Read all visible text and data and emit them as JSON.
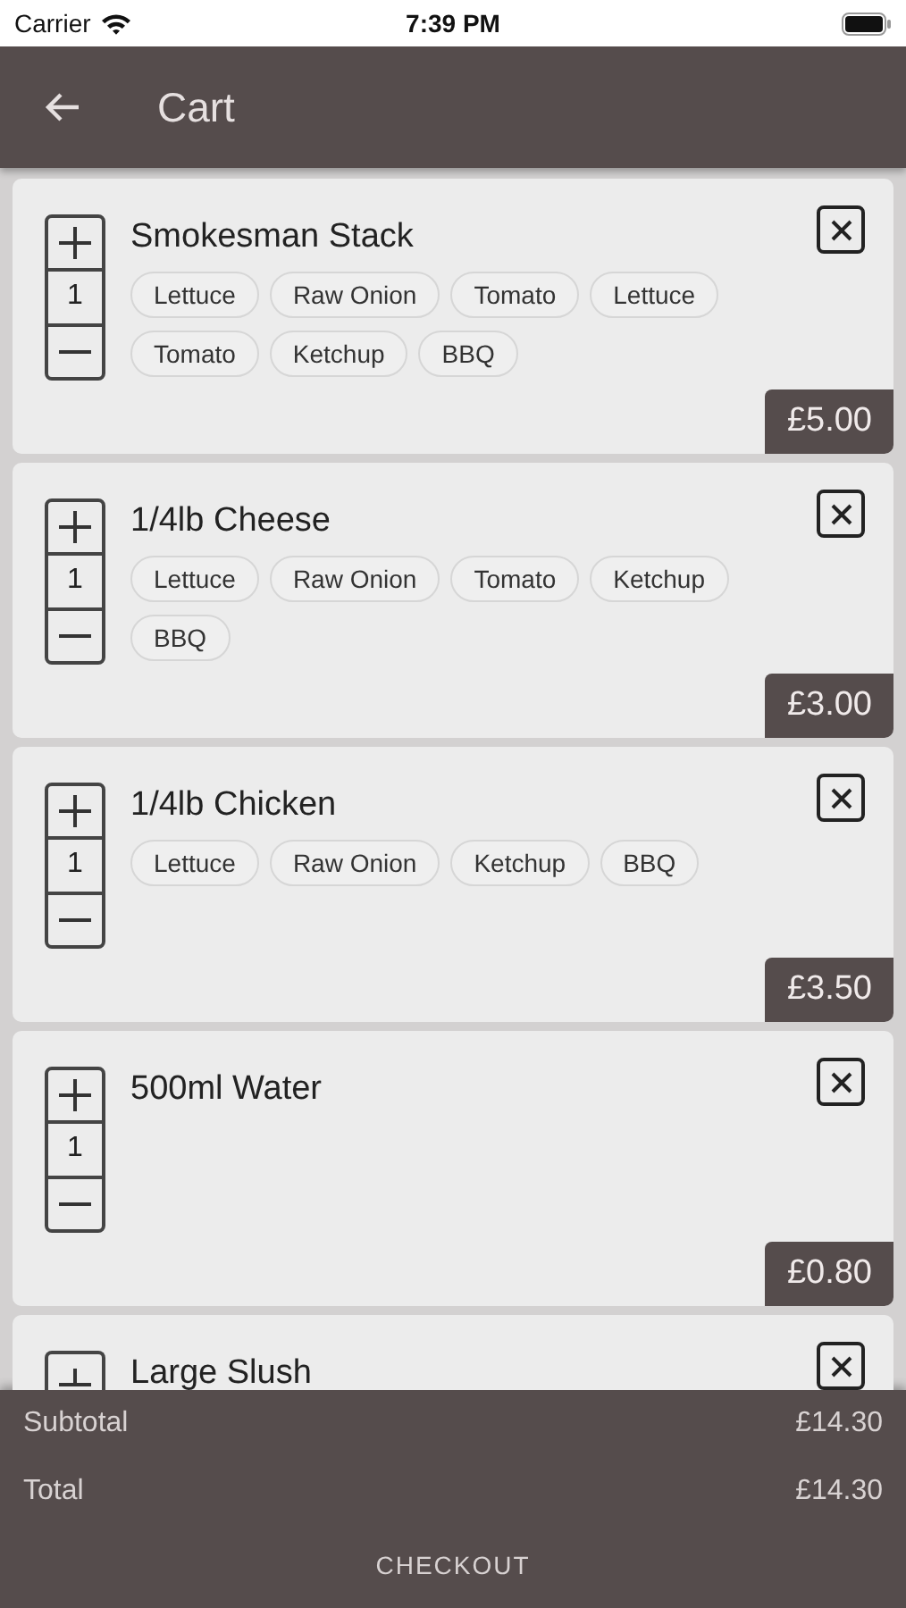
{
  "status_bar": {
    "carrier": "Carrier",
    "time": "7:39 PM"
  },
  "header": {
    "title": "Cart"
  },
  "items": [
    {
      "name": "Smokesman Stack",
      "quantity": "1",
      "toppings": [
        "Lettuce",
        "Raw Onion",
        "Tomato",
        "Lettuce",
        "Tomato",
        "Ketchup",
        "BBQ"
      ],
      "price": "£5.00"
    },
    {
      "name": "1/4lb Cheese",
      "quantity": "1",
      "toppings": [
        "Lettuce",
        "Raw Onion",
        "Tomato",
        "Ketchup",
        "BBQ"
      ],
      "price": "£3.00"
    },
    {
      "name": "1/4lb Chicken",
      "quantity": "1",
      "toppings": [
        "Lettuce",
        "Raw Onion",
        "Ketchup",
        "BBQ"
      ],
      "price": "£3.50"
    },
    {
      "name": "500ml Water",
      "quantity": "1",
      "price": "£0.80"
    },
    {
      "name": "Large Slush"
    }
  ],
  "summary": {
    "subtotal_label": "Subtotal",
    "subtotal": "£14.30",
    "total_label": "Total",
    "total": "£14.30",
    "checkout": "CHECKOUT"
  }
}
